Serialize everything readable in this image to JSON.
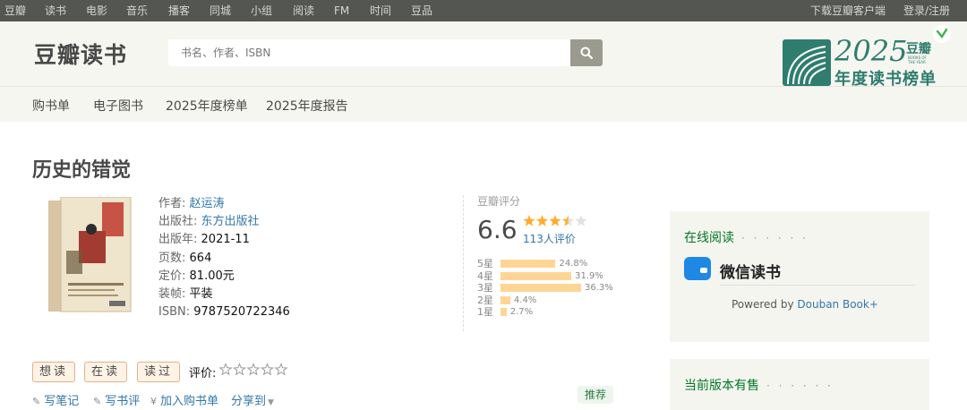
{
  "topnav": {
    "left": [
      "豆瓣",
      "读书",
      "电影",
      "音乐",
      "播客",
      "同城",
      "小组",
      "阅读",
      "FM",
      "时间",
      "豆品"
    ],
    "download": "下载豆瓣客户端",
    "login": "登录/注册"
  },
  "header": {
    "logo": "豆瓣读书",
    "search_placeholder": "书名、作者、ISBN",
    "subnav": [
      "购书单",
      "电子图书",
      "2025年度榜单",
      "2025年度报告"
    ],
    "banner": {
      "year": "2025",
      "brand": "豆瓣",
      "small": "BOOKS OF THE YEAR",
      "caption": "年度读书榜单"
    }
  },
  "book": {
    "title": "历史的错觉",
    "info": [
      {
        "label": "作者:",
        "value": "赵运涛",
        "link": true
      },
      {
        "label": "出版社:",
        "value": "东方出版社",
        "link": true
      },
      {
        "label": "出版年:",
        "value": "2021-11",
        "link": false
      },
      {
        "label": "页数:",
        "value": "664",
        "link": false
      },
      {
        "label": "定价:",
        "value": "81.00元",
        "link": false
      },
      {
        "label": "装帧:",
        "value": "平装",
        "link": false
      },
      {
        "label": "ISBN:",
        "value": "9787520722346",
        "link": false
      }
    ]
  },
  "rating": {
    "header": "豆瓣评分",
    "score": "6.6",
    "stars": 3.5,
    "count": "113人评价",
    "distribution": [
      {
        "label": "5星",
        "percent": "24.8%",
        "value": 24.8
      },
      {
        "label": "4星",
        "percent": "31.9%",
        "value": 31.9
      },
      {
        "label": "3星",
        "percent": "36.3%",
        "value": 36.3
      },
      {
        "label": "2星",
        "percent": "4.4%",
        "value": 4.4
      },
      {
        "label": "1星",
        "percent": "2.7%",
        "value": 2.7
      }
    ]
  },
  "actions": {
    "want": "想读",
    "reading": "在读",
    "read": "读过",
    "rate_label": "评价:",
    "links": [
      "写笔记",
      "写书评",
      "加入购书单",
      "分享到"
    ],
    "recommend": "推荐"
  },
  "sidebar": {
    "online_title": "在线阅读",
    "dots": "· · · · · ·",
    "wechat": "微信读书",
    "powered_by": "Powered by",
    "powered_link": "Douban Book+",
    "edition_title": "当前版本有售"
  },
  "colors": {
    "topnav_bg": "#545652",
    "header_bg": "#f6f6f1",
    "link": "#3377aa",
    "green": "#007722",
    "star": "#ffac2d",
    "brand_teal": "#2f7d6e"
  }
}
